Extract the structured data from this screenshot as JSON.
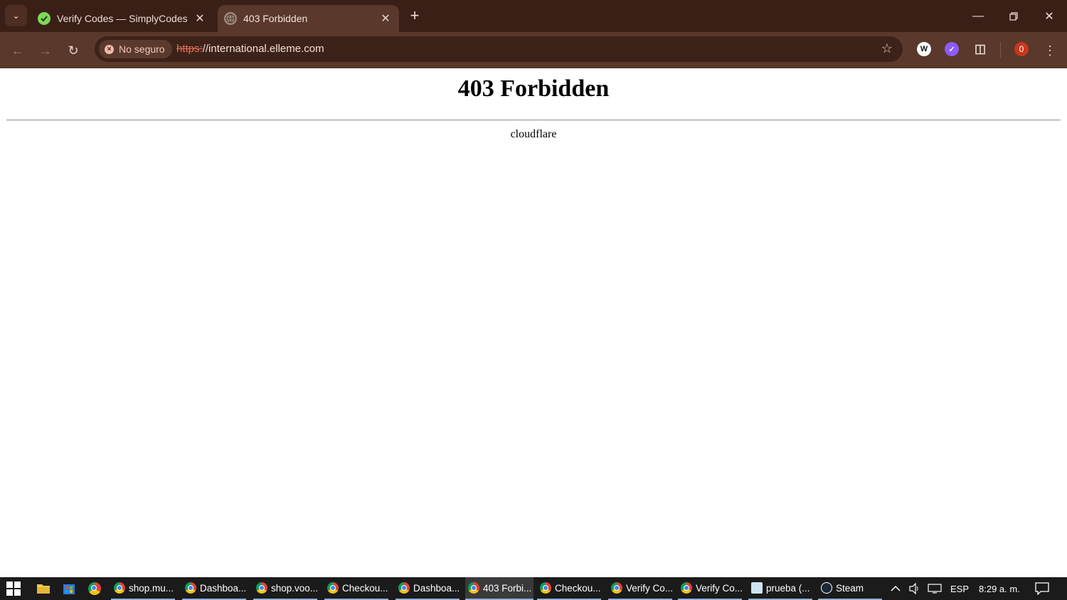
{
  "browser": {
    "tabs": [
      {
        "title": "Verify Codes — SimplyCodes",
        "favicon": "simplycodes-icon",
        "active": false
      },
      {
        "title": "403 Forbidden",
        "favicon": "globe-icon",
        "active": true
      }
    ],
    "security_chip": "No seguro",
    "url_scheme": "https:",
    "url_rest": "//international.elleme.com",
    "profile_badge": "0"
  },
  "page": {
    "heading": "403 Forbidden",
    "footer": "cloudflare"
  },
  "taskbar": {
    "apps": [
      {
        "label": "shop.mu...",
        "icon": "chrome-icon"
      },
      {
        "label": "Dashboa...",
        "icon": "chrome-icon"
      },
      {
        "label": "shop.voo...",
        "icon": "chrome-icon"
      },
      {
        "label": "Checkou...",
        "icon": "chrome-icon"
      },
      {
        "label": "Dashboa...",
        "icon": "chrome-icon"
      },
      {
        "label": "403 Forbi...",
        "icon": "chrome-icon",
        "current": true
      },
      {
        "label": "Checkou...",
        "icon": "chrome-icon"
      },
      {
        "label": "Verify Co...",
        "icon": "chrome-icon"
      },
      {
        "label": "Verify Co...",
        "icon": "chrome-icon"
      },
      {
        "label": "prueba (...",
        "icon": "notepad-icon"
      },
      {
        "label": "Steam",
        "icon": "steam-icon"
      }
    ],
    "language": "ESP",
    "clock": "8:29 a. m."
  },
  "colors": {
    "titlebar": "#3a1f17",
    "toolbar": "#5a382b",
    "omnibox": "#3d2219",
    "not_secure_red": "#e96f57",
    "taskbar": "#1b1b1b"
  }
}
